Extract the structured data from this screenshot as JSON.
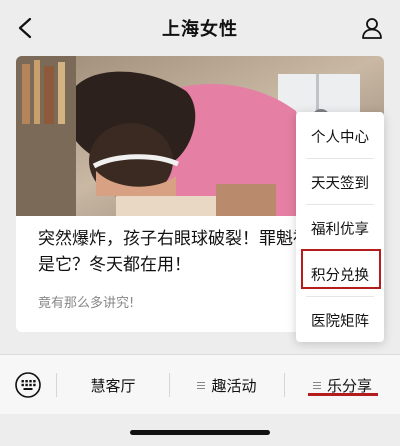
{
  "header": {
    "title": "上海女性",
    "back_icon": "chevron-left-icon",
    "profile_icon": "person-icon"
  },
  "card": {
    "title": "突然爆炸，孩子右眼球破裂！罪魁祸首竟是它？冬天都在用！",
    "subtitle": "竟有那么多讲究!"
  },
  "popup_menu": {
    "items": [
      "个人中心",
      "天天签到",
      "福利优享",
      "积分兑换",
      "医院矩阵"
    ],
    "highlighted_index": 3,
    "highlight_color": "#b51c1c"
  },
  "bottom_menu": {
    "keyboard_icon": "keyboard-icon",
    "items": [
      {
        "label": "慧客厅",
        "has_submenu": false
      },
      {
        "label": "趣活动",
        "has_submenu": true
      },
      {
        "label": "乐分享",
        "has_submenu": true,
        "active": true
      }
    ]
  }
}
